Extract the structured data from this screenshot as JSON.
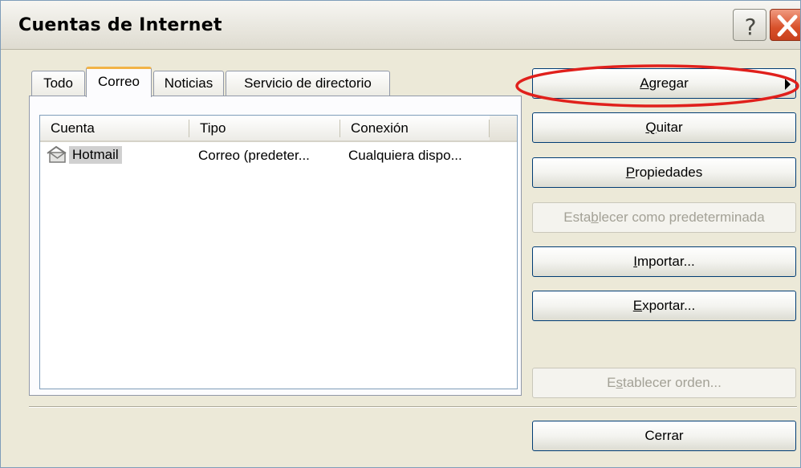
{
  "window": {
    "title": "Cuentas de Internet"
  },
  "titlebar_buttons": {
    "help_icon": "help-icon",
    "close_icon": "close-icon"
  },
  "tabs": [
    {
      "label": "Todo",
      "active": false
    },
    {
      "label": "Correo",
      "active": true
    },
    {
      "label": "Noticias",
      "active": false
    },
    {
      "label": "Servicio de directorio",
      "active": false
    }
  ],
  "listview": {
    "columns": [
      "Cuenta",
      "Tipo",
      "Conexión"
    ],
    "rows": [
      {
        "cuenta": "Hotmail",
        "tipo": "Correo (predeter...",
        "conexion": "Cualquiera dispo...",
        "icon": "mail-account-icon"
      }
    ]
  },
  "buttons": {
    "agregar": {
      "pre": "",
      "accel": "A",
      "post": "gregar",
      "enabled": true,
      "has_submenu": true
    },
    "quitar": {
      "pre": "",
      "accel": "Q",
      "post": "uitar",
      "enabled": true
    },
    "propiedades": {
      "pre": "",
      "accel": "P",
      "post": "ropiedades",
      "enabled": true
    },
    "predeterminada": {
      "pre": "Esta",
      "accel": "b",
      "post": "lecer como predeterminada",
      "enabled": false
    },
    "importar": {
      "pre": "",
      "accel": "I",
      "post": "mportar...",
      "enabled": true
    },
    "exportar": {
      "pre": "",
      "accel": "E",
      "post": "xportar...",
      "enabled": true
    },
    "orden": {
      "pre": "E",
      "accel": "s",
      "post": "tablecer orden...",
      "enabled": false
    },
    "cerrar": {
      "pre": "Cerrar",
      "accel": "",
      "post": "",
      "enabled": true
    }
  },
  "colors": {
    "highlight_ellipse": "#e0201c",
    "active_tab_accent": "#f2b347",
    "button_border": "#003c74"
  }
}
